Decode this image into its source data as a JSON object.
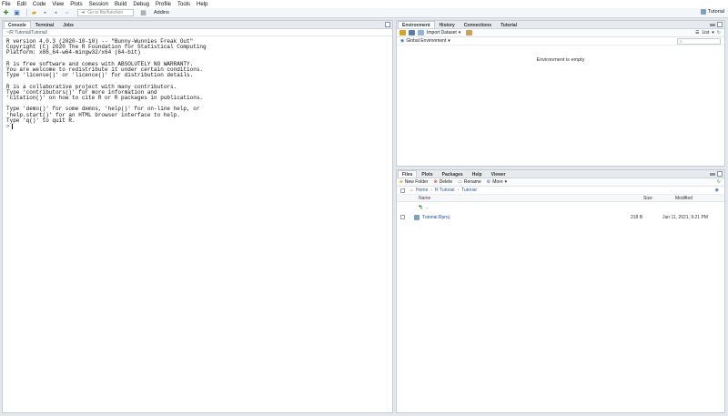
{
  "menu": [
    "File",
    "Edit",
    "Code",
    "View",
    "Plots",
    "Session",
    "Build",
    "Debug",
    "Profile",
    "Tools",
    "Help"
  ],
  "toolbar": {
    "goto_placeholder": "Go to file/function",
    "addins": "Addins",
    "project": "Tutorial"
  },
  "console": {
    "tabs": [
      "Console",
      "Terminal",
      "Jobs"
    ],
    "path": "~/R Tutorial/Tutorial/",
    "output": "R version 4.0.3 (2020-10-10) -- \"Bunny-Wunnies Freak Out\"\nCopyright (C) 2020 The R Foundation for Statistical Computing\nPlatform: x86_64-w64-mingw32/x64 (64-bit)\n\nR is free software and comes with ABSOLUTELY NO WARRANTY.\nYou are welcome to redistribute it under certain conditions.\nType 'license()' or 'licence()' for distribution details.\n\nR is a collaborative project with many contributors.\nType 'contributors()' for more information and\n'citation()' on how to cite R or R packages in publications.\n\nType 'demo()' for some demos, 'help()' for on-line help, or\n'help.start()' for an HTML browser interface to help.\nType 'q()' to quit R.\n",
    "prompt": ">"
  },
  "env": {
    "tabs": [
      "Environment",
      "History",
      "Connections",
      "Tutorial"
    ],
    "import_dataset": "Import Dataset",
    "list_label": "List",
    "scope": "Global Environment",
    "empty": "Environment is empty"
  },
  "files": {
    "tabs": [
      "Files",
      "Plots",
      "Packages",
      "Help",
      "Viewer"
    ],
    "actions": {
      "new_folder": "New Folder",
      "delete": "Delete",
      "rename": "Rename",
      "more": "More"
    },
    "breadcrumb": [
      "Home",
      "R Tutorial",
      "Tutorial"
    ],
    "columns": {
      "name": "Name",
      "size": "Size",
      "modified": "Modified"
    },
    "parent": "..",
    "rows": [
      {
        "name": "Tutorial.Rproj",
        "size": "218 B",
        "modified": "Jan 11, 2021, 9:21 PM"
      }
    ]
  }
}
